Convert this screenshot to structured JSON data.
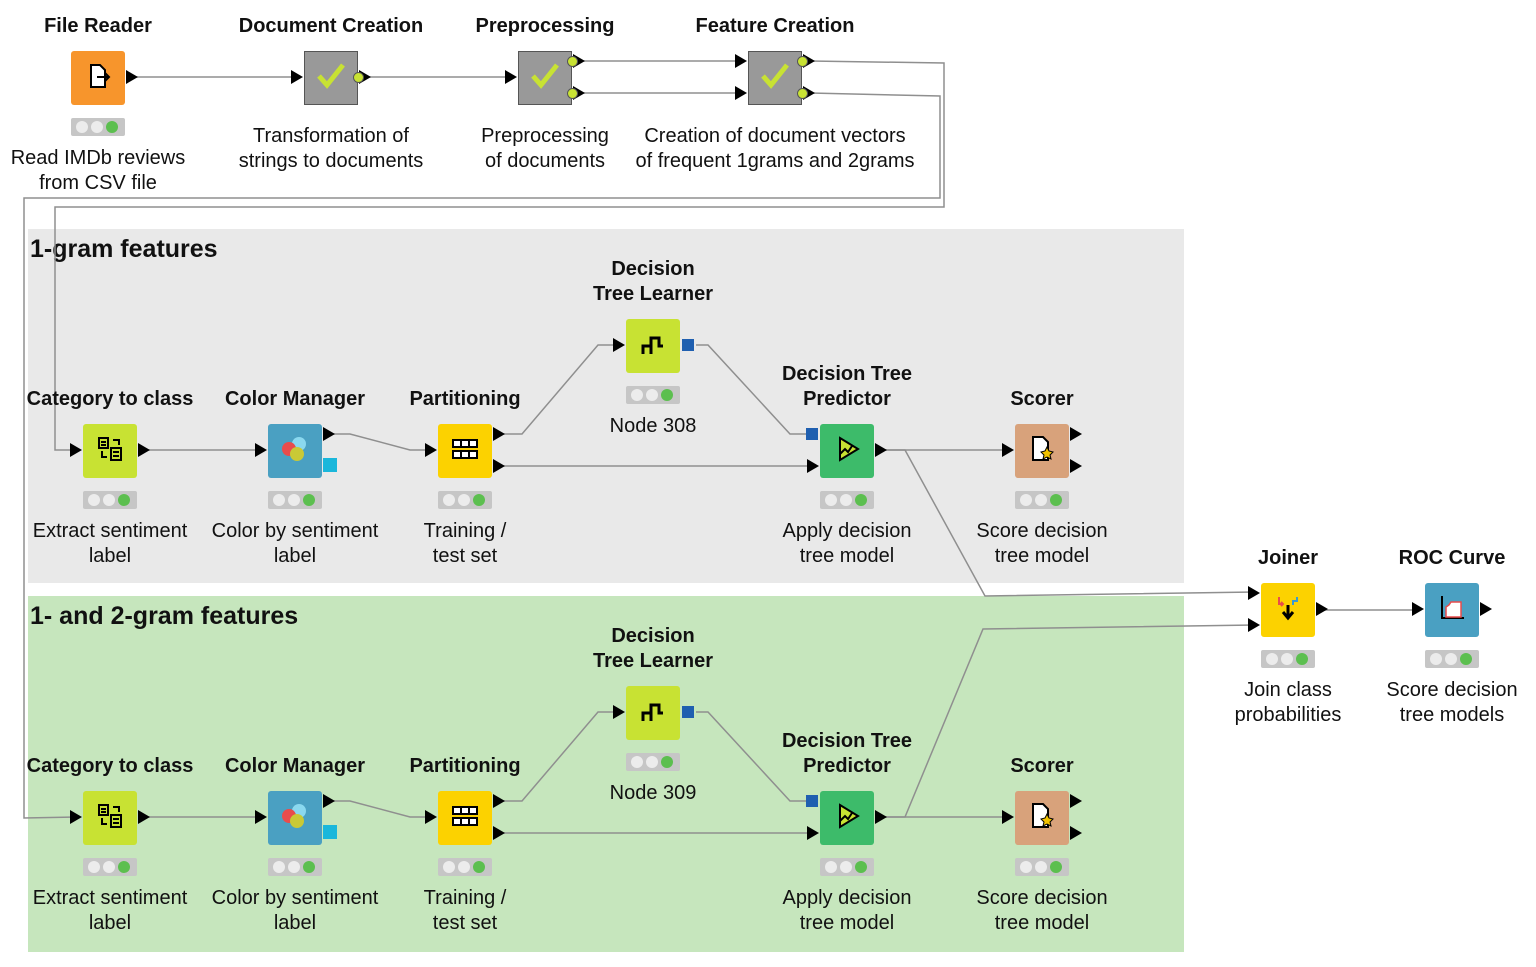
{
  "sections": [
    {
      "title": "1-gram features",
      "background": "#e9e9e9"
    },
    {
      "title": "1- and 2-gram features",
      "background": "#c6e6bd"
    }
  ],
  "nodes": [
    {
      "id": "file-reader",
      "title": "File Reader",
      "label": "Read IMDb reviews\nfrom CSV file",
      "icon": "file-read-icon",
      "color": "#f7952c",
      "status": "executed"
    },
    {
      "id": "document-creation",
      "title": "Document Creation",
      "label": "Transformation of\nstrings to documents",
      "icon": "checkmark-icon",
      "color": "#999999",
      "metanode": true
    },
    {
      "id": "preprocessing",
      "title": "Preprocessing",
      "label": "Preprocessing\nof documents",
      "icon": "checkmark-icon",
      "color": "#999999",
      "metanode": true
    },
    {
      "id": "feature-creation",
      "title": "Feature Creation",
      "label": "Creation of document vectors\nof frequent 1grams and 2grams",
      "icon": "checkmark-icon",
      "color": "#999999",
      "metanode": true
    },
    {
      "id": "cat1",
      "title": "Category to class",
      "label": "Extract sentiment\nlabel",
      "icon": "category-to-class-icon",
      "color": "#c8e233",
      "status": "executed"
    },
    {
      "id": "color1",
      "title": "Color Manager",
      "label": "Color by sentiment\nlabel",
      "icon": "color-circles-icon",
      "color": "#4aa0c2",
      "status": "executed"
    },
    {
      "id": "part1",
      "title": "Partitioning",
      "label": "Training /\ntest set",
      "icon": "partition-grid-icon",
      "color": "#fcd200",
      "status": "executed"
    },
    {
      "id": "learner1",
      "title": "Decision\nTree Learner",
      "label": "Node 308",
      "icon": "decision-tree-icon",
      "color": "#c8e233",
      "status": "executed"
    },
    {
      "id": "predictor1",
      "title": "Decision Tree\nPredictor",
      "label": "Apply decision\ntree model",
      "icon": "predictor-play-icon",
      "color": "#3dbb6a",
      "status": "executed"
    },
    {
      "id": "scorer1",
      "title": "Scorer",
      "label": "Score decision\ntree model",
      "icon": "scorer-document-icon",
      "color": "#d8a27b",
      "status": "executed"
    },
    {
      "id": "cat2",
      "title": "Category to class",
      "label": "Extract sentiment\nlabel",
      "icon": "category-to-class-icon",
      "color": "#c8e233",
      "status": "executed"
    },
    {
      "id": "color2",
      "title": "Color Manager",
      "label": "Color by sentiment\nlabel",
      "icon": "color-circles-icon",
      "color": "#4aa0c2",
      "status": "executed"
    },
    {
      "id": "part2",
      "title": "Partitioning",
      "label": "Training /\ntest set",
      "icon": "partition-grid-icon",
      "color": "#fcd200",
      "status": "executed"
    },
    {
      "id": "learner2",
      "title": "Decision\nTree Learner",
      "label": "Node 309",
      "icon": "decision-tree-icon",
      "color": "#c8e233",
      "status": "executed"
    },
    {
      "id": "predictor2",
      "title": "Decision Tree\nPredictor",
      "label": "Apply decision\ntree model",
      "icon": "predictor-play-icon",
      "color": "#3dbb6a",
      "status": "executed"
    },
    {
      "id": "scorer2",
      "title": "Scorer",
      "label": "Score decision\ntree model",
      "icon": "scorer-document-icon",
      "color": "#d8a27b",
      "status": "executed"
    },
    {
      "id": "joiner",
      "title": "Joiner",
      "label": "Join class\nprobabilities",
      "icon": "joiner-arrows-icon",
      "color": "#fcd200",
      "status": "executed"
    },
    {
      "id": "roc",
      "title": "ROC Curve",
      "label": "Score decision\ntree models",
      "icon": "roc-chart-icon",
      "color": "#4aa0c2",
      "status": "executed"
    }
  ]
}
